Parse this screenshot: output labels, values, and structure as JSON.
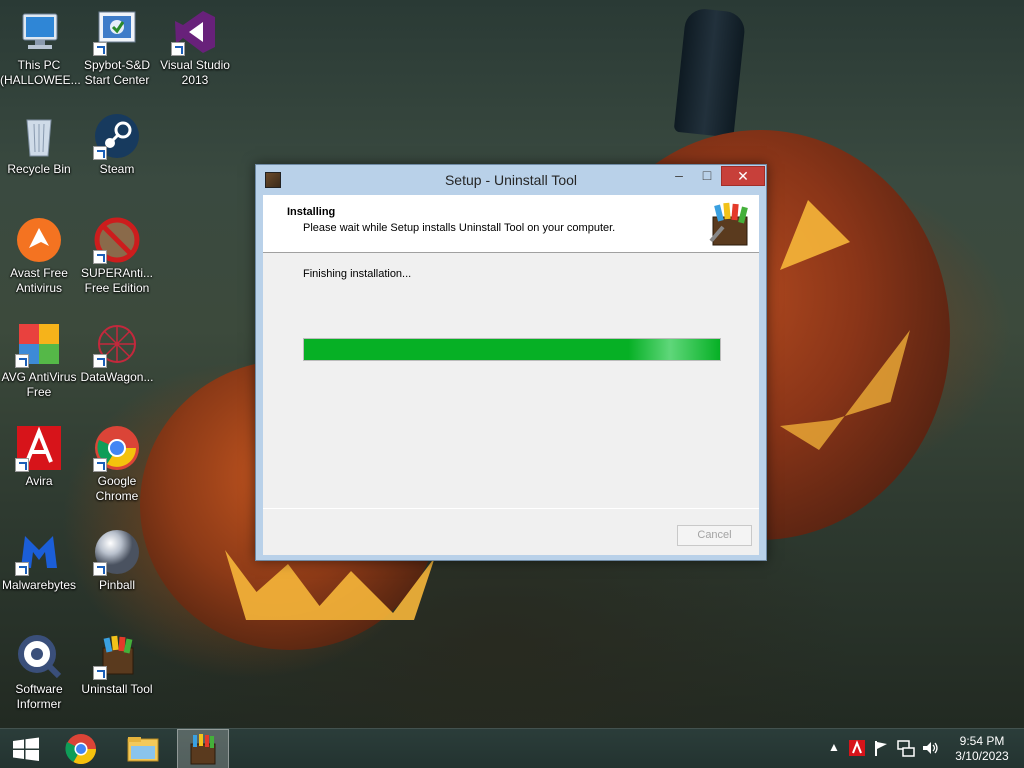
{
  "desktop": {
    "icons": [
      {
        "label": "This PC (HALLOWEE...",
        "icon": "computer-icon"
      },
      {
        "label": "Spybot-S&D Start Center",
        "icon": "spybot-icon"
      },
      {
        "label": "Visual Studio 2013",
        "icon": "visual-studio-icon"
      },
      {
        "label": "Recycle Bin",
        "icon": "recycle-bin-icon"
      },
      {
        "label": "Steam",
        "icon": "steam-icon"
      },
      {
        "label": "Avast Free Antivirus",
        "icon": "avast-icon"
      },
      {
        "label": "SUPERAnti... Free Edition",
        "icon": "superantispyware-icon"
      },
      {
        "label": "AVG AntiVirus Free",
        "icon": "avg-icon"
      },
      {
        "label": "DataWagon...",
        "icon": "datawagon-icon"
      },
      {
        "label": "Avira",
        "icon": "avira-icon"
      },
      {
        "label": "Google Chrome",
        "icon": "chrome-icon"
      },
      {
        "label": "Malwarebytes",
        "icon": "malwarebytes-icon"
      },
      {
        "label": "Pinball",
        "icon": "pinball-icon"
      },
      {
        "label": "Software Informer",
        "icon": "software-informer-icon"
      },
      {
        "label": "Uninstall Tool",
        "icon": "uninstall-tool-icon"
      }
    ]
  },
  "window": {
    "title": "Setup - Uninstall Tool",
    "heading": "Installing",
    "subheading": "Please wait while Setup installs Uninstall Tool on your computer.",
    "status": "Finishing installation...",
    "progress": 1.0,
    "cancel_label": "Cancel",
    "controls": {
      "minimize": "–",
      "maximize": "□",
      "close": "✕"
    },
    "colors": {
      "titlebar": "#b9d1e9",
      "progress": "#06b025",
      "close": "#c7403a"
    }
  },
  "taskbar": {
    "start_icon": "windows-logo-icon",
    "pinned": [
      "chrome-icon",
      "file-explorer-icon",
      "uninstall-tool-setup-icon"
    ],
    "tray_icons": [
      "show-hidden-icons-icon",
      "antivirus-tray-icon",
      "action-center-flag-icon",
      "network-icon",
      "volume-icon"
    ],
    "time": "9:54 PM",
    "date": "3/10/2023"
  }
}
